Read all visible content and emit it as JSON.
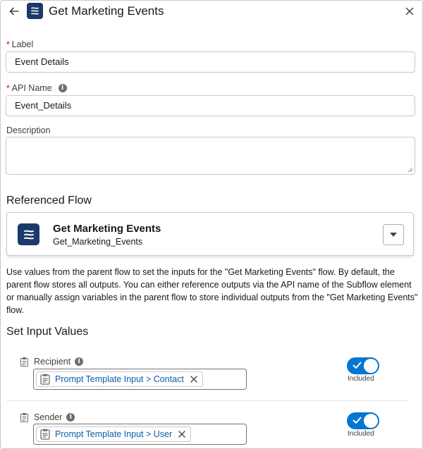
{
  "header": {
    "title": "Get Marketing Events",
    "back_icon": "arrow-left-icon",
    "flow_icon": "flow-icon",
    "close_icon": "close-icon"
  },
  "form": {
    "label": {
      "required_mark": "*",
      "text": "Label",
      "value": "Event Details"
    },
    "api_name": {
      "required_mark": "*",
      "text": "API Name",
      "value": "Event_Details",
      "info_icon": "info-icon"
    },
    "description": {
      "text": "Description",
      "value": ""
    }
  },
  "referenced_flow": {
    "section_title": "Referenced Flow",
    "flow_name": "Get Marketing Events",
    "flow_api_name": "Get_Marketing_Events",
    "dropdown_icon": "caret-down-icon"
  },
  "help_text": "Use values from the parent flow to set the inputs for the \"Get Marketing Events\" flow. By default, the parent flow stores all outputs. You can either reference outputs via the API name of the Subflow element or manually assign variables in the parent flow to store individual outputs from the \"Get Marketing Events\" flow.",
  "set_input_values": {
    "section_title": "Set Input Values",
    "inputs": [
      {
        "label": "Recipient",
        "value": "Prompt Template Input > Contact",
        "toggle_label": "Included",
        "included": true
      },
      {
        "label": "Sender",
        "value": "Prompt Template Input > User",
        "toggle_label": "Included",
        "included": true
      }
    ]
  },
  "colors": {
    "brand": "#0176d3",
    "flow_icon_bg": "#1b3a6b",
    "required": "#ba0517",
    "link": "#0b5cab"
  }
}
